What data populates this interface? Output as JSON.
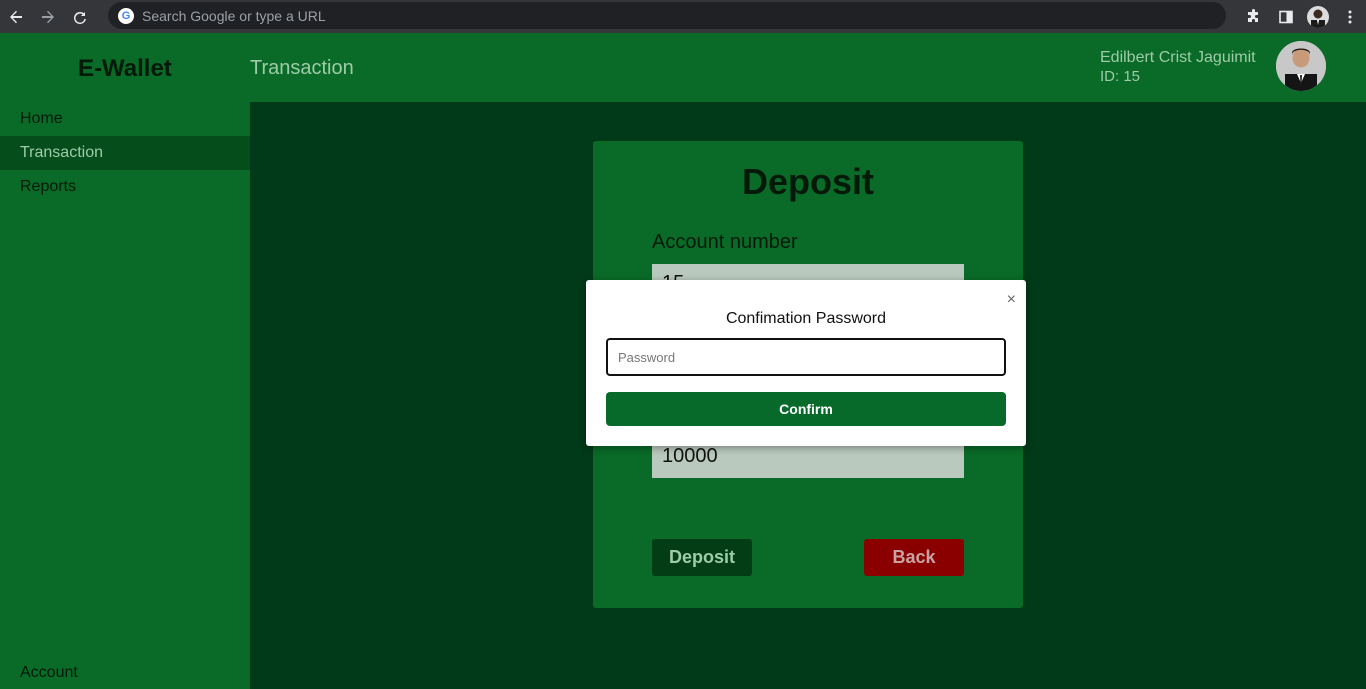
{
  "browser": {
    "omnibox_placeholder": "Search Google or type a URL",
    "google_glyph": "G"
  },
  "header": {
    "brand": "E-Wallet",
    "page_title": "Transaction",
    "user_name": "Edilbert Crist Jaguimit",
    "user_id": "ID: 15"
  },
  "sidebar": {
    "items": [
      {
        "label": "Home"
      },
      {
        "label": "Transaction"
      },
      {
        "label": "Reports"
      }
    ],
    "bottom_item": "Account"
  },
  "card": {
    "title": "Deposit",
    "account_label": "Account number",
    "account_value": "15",
    "amount_value": "10000",
    "deposit_label": "Deposit",
    "back_label": "Back"
  },
  "modal": {
    "title": "Confimation Password",
    "close_glyph": "×",
    "password_placeholder": "Password",
    "confirm_label": "Confirm"
  },
  "colors": {
    "header_green": "#0a6a27",
    "content_bg": "#003a18",
    "confirm_green": "#076a2a",
    "back_red": "#8a0000"
  }
}
